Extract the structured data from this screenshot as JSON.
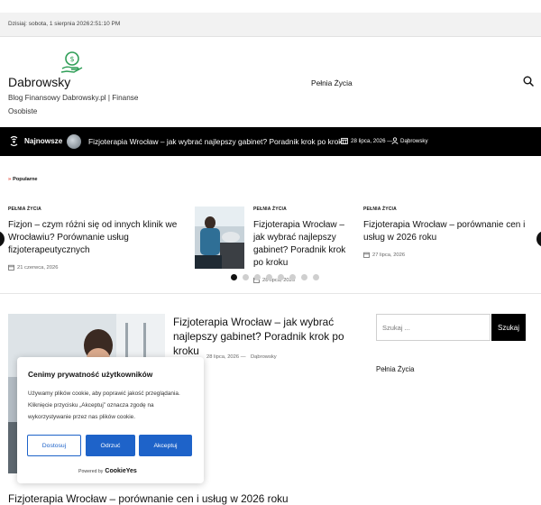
{
  "topbar": {
    "date": "Dzisiaj: sobota, 1 sierpnia 2026",
    "time": "2:51:10 PM"
  },
  "header": {
    "site_title": "Dabrowsky",
    "site_description": "Blog Finansowy Dabrowsky.pl | Finanse Osobiste",
    "nav_item": "Pełnia Życia",
    "logo_icon": "money-hand-icon",
    "search_icon": "search-icon"
  },
  "ticker": {
    "label": "Najnowsze",
    "title": "Fizjoterapia Wrocław – jak wybrać najlepszy gabinet? Poradnik krok po kroku",
    "date": "28 lipca, 2026",
    "separator": "—",
    "author": "Dąbrowsky"
  },
  "popular": {
    "label": "Popularne"
  },
  "slides": [
    {
      "category": "PEŁNIA ŻYCIA",
      "title": "Fizjon – czym różni się od innych klinik we Wrocławiu? Porównanie usług fizjoterapeutycznych",
      "date": "21 czerwca, 2026"
    },
    {
      "category": "PEŁNIA ŻYCIA",
      "title": "Fizjoterapia Wrocław – jak wybrać najlepszy gabinet? Poradnik krok po kroku",
      "date": "28 lipca, 2026"
    },
    {
      "category": "PEŁNIA ŻYCIA",
      "title": "Fizjoterapia Wrocław – porównanie cen i usług w 2026 roku",
      "date": "27 lipca, 2026"
    }
  ],
  "carousel": {
    "dot_count": 8,
    "active_index": 0
  },
  "featured": {
    "title": "Fizjoterapia Wrocław – jak wybrać najlepszy gabinet? Poradnik krok po kroku",
    "date": "28 lipca, 2026",
    "separator": "—",
    "author": "Dąbrowsky"
  },
  "sidebar": {
    "search_placeholder": "Szukaj ...",
    "search_button": "Szukaj",
    "nav_item": "Pełnia Życia"
  },
  "next_post": {
    "title": "Fizjoterapia Wrocław – porównanie cen i usług w 2026 roku"
  },
  "cookie": {
    "title": "Cenimy prywatność użytkowników",
    "text": "Używamy plików cookie, aby poprawić jakość przeglądania. Kliknięcie przycisku „Akceptuj” oznacza zgodę na wykorzystywanie przez nas plików cookie.",
    "customize": "Dostosuj",
    "reject": "Odrzuć",
    "accept": "Akceptuj",
    "powered_by": "Powered by",
    "brand": "CookieYes"
  },
  "colors": {
    "accent_blue": "#1e63c9",
    "ticker_bg": "#000000",
    "logo_green": "#2f9e57"
  }
}
